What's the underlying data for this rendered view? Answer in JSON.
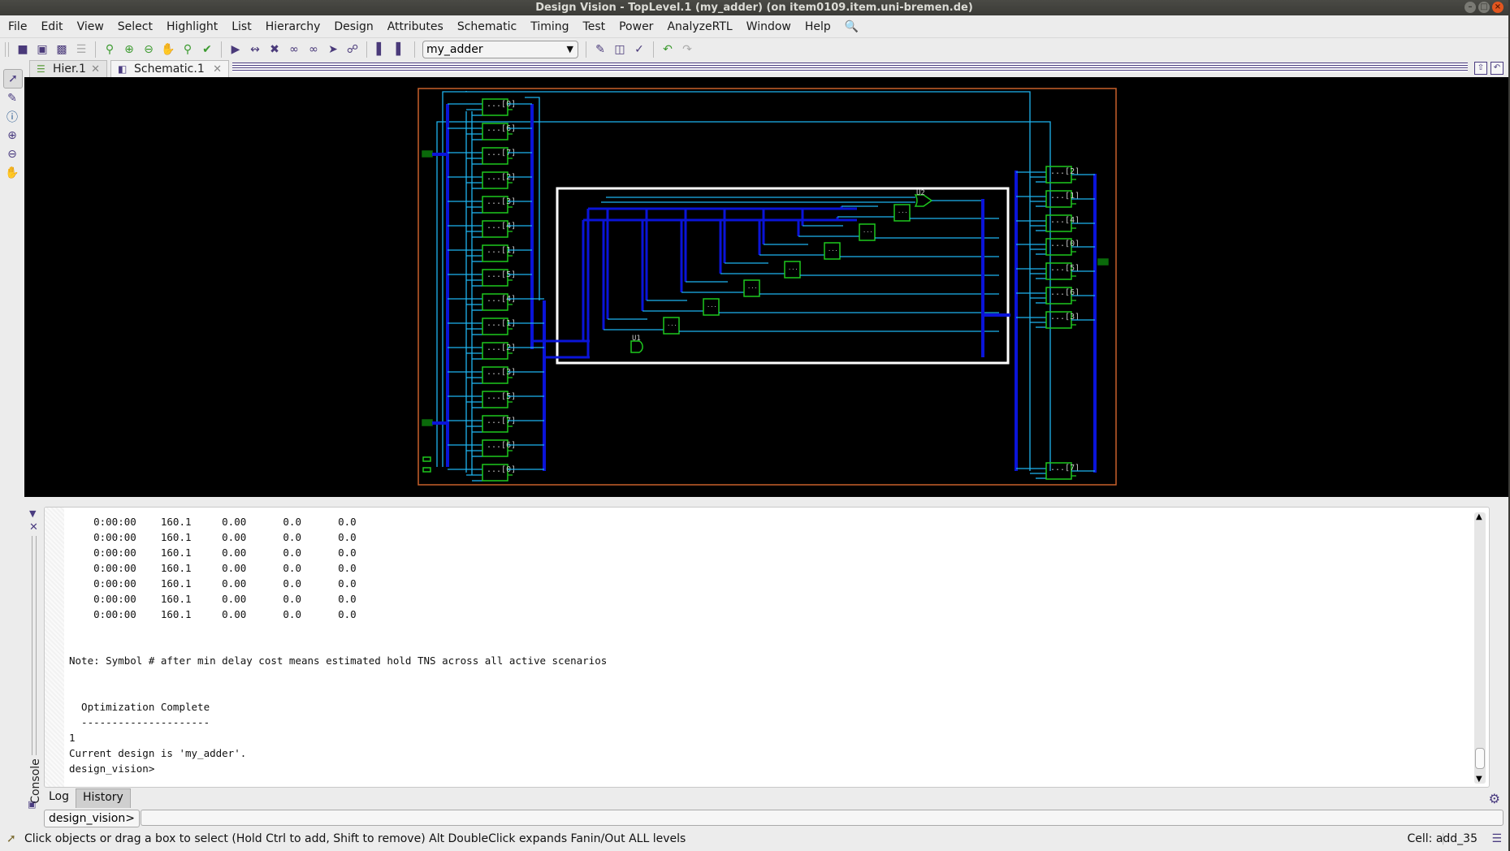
{
  "window": {
    "title": "Design Vision - TopLevel.1 (my_adder) (on item0109.item.uni-bremen.de)",
    "buttons": [
      "minimize",
      "maximize",
      "close"
    ]
  },
  "menubar": {
    "items": [
      "File",
      "Edit",
      "View",
      "Select",
      "Highlight",
      "List",
      "Hierarchy",
      "Design",
      "Attributes",
      "Schematic",
      "Timing",
      "Test",
      "Power",
      "AnalyzeRTL",
      "Window",
      "Help"
    ],
    "search_icon": "magnifier-icon"
  },
  "toolbar": {
    "file_icons": [
      "open-folder-icon",
      "save-icon",
      "print-icon",
      "script-editor-icon"
    ],
    "view_icons": [
      "zoom-fit-icon",
      "zoom-in-icon",
      "zoom-out-icon",
      "pan-hand-icon",
      "zoom-full-icon",
      "select-tool-icon"
    ],
    "schematic_icons": [
      "gate-icon",
      "bus-icon",
      "expand-icon",
      "fanin-icon",
      "fanout-icon",
      "path-icon",
      "hierarchy-icon"
    ],
    "report_icons": [
      "report-ps-icon",
      "report-nc-icon"
    ],
    "design_selector": {
      "value": "my_adder"
    },
    "analysis_icons": [
      "erase-icon",
      "timing-bars-icon",
      "check-icon"
    ],
    "nav_icons": [
      "back-icon",
      "forward-icon"
    ]
  },
  "tabs": [
    {
      "label": "Hier.1",
      "icon": "hierarchy-icon",
      "active": false
    },
    {
      "label": "Schematic.1",
      "icon": "schematic-icon",
      "active": true
    }
  ],
  "left_tools": [
    "select-arrow-icon",
    "pencil-icon",
    "info-icon",
    "zoom-in-icon",
    "zoom-out-icon",
    "hand-icon"
  ],
  "schematic": {
    "left_cells_top": [
      "...[0]",
      "...[6]",
      "...[7]",
      "...[2]",
      "...[3]",
      "...[4]",
      "...[1]",
      "...[5]"
    ],
    "left_cells_bottom": [
      "...[4]",
      "...[1]",
      "...[2]",
      "...[3]",
      "...[5]",
      "...[7]",
      "...[6]",
      "...[0]"
    ],
    "right_cells": [
      "...[2]",
      "...[1]",
      "...[4]",
      "...[0]",
      "...[5]",
      "...[6]",
      "...[3]",
      "...[7]"
    ],
    "gates": {
      "u1": "U1",
      "u2": "U2",
      "adder_cell": "..."
    }
  },
  "console": {
    "rows": [
      [
        "0:00:00",
        "160.1",
        "0.00",
        "0.0",
        "0.0"
      ],
      [
        "0:00:00",
        "160.1",
        "0.00",
        "0.0",
        "0.0"
      ],
      [
        "0:00:00",
        "160.1",
        "0.00",
        "0.0",
        "0.0"
      ],
      [
        "0:00:00",
        "160.1",
        "0.00",
        "0.0",
        "0.0"
      ],
      [
        "0:00:00",
        "160.1",
        "0.00",
        "0.0",
        "0.0"
      ],
      [
        "0:00:00",
        "160.1",
        "0.00",
        "0.0",
        "0.0"
      ],
      [
        "0:00:00",
        "160.1",
        "0.00",
        "0.0",
        "0.0"
      ]
    ],
    "note": "Note: Symbol # after min delay cost means estimated hold TNS across all active scenarios",
    "optimization": "  Optimization Complete",
    "dashes": "  ---------------------",
    "result": "1",
    "current_design": "Current design is 'my_adder'.",
    "prompt_line": "design_vision>",
    "side_label": "Console",
    "tabs": [
      "Log",
      "History"
    ],
    "prompt_label": "design_vision>",
    "command_value": ""
  },
  "status": {
    "hint": "Click objects or drag a box to select (Hold Ctrl to add, Shift to remove) Alt DoubleClick expands Fanin/Out ALL levels",
    "cell": "Cell: add_35"
  }
}
